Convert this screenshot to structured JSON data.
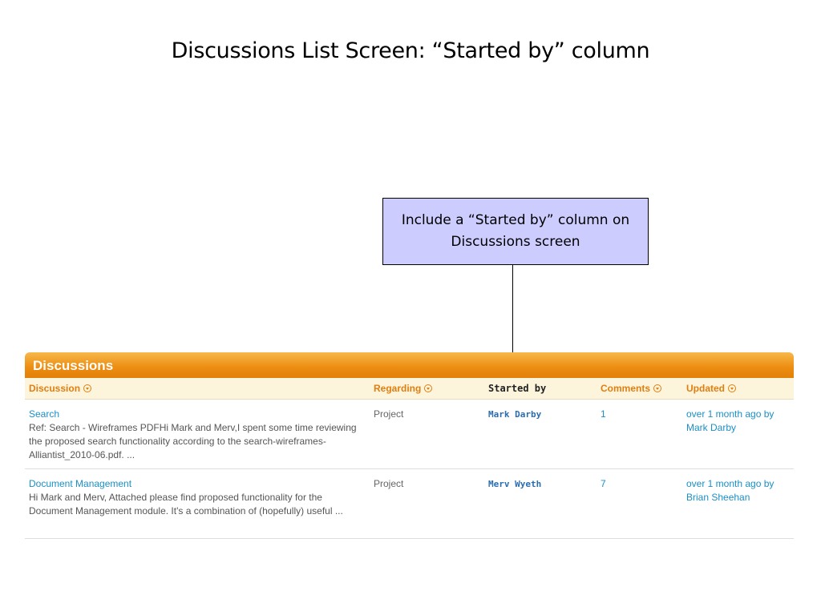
{
  "slide": {
    "title": "Discussions List Screen: “Started by” column",
    "callout": "Include a “Started by” column on Discussions screen"
  },
  "panel": {
    "title": "Discussions",
    "columns": {
      "discussion": "Discussion",
      "regarding": "Regarding",
      "started_by": "Started by",
      "comments": "Comments",
      "updated": "Updated"
    },
    "rows": [
      {
        "title": "Search",
        "excerpt": "Ref: Search - Wireframes PDFHi Mark and Merv,I spent some time reviewing the proposed search functionality according to the search-wireframes-Alliantist_2010-06.pdf. ...",
        "regarding": "Project",
        "started_by": "Mark Darby",
        "comments": "1",
        "updated": "over 1 month ago by",
        "updated_by": "Mark Darby"
      },
      {
        "title": "Document Management",
        "excerpt": "Hi Mark and Merv, Attached please find proposed functionality for the Document Management module. It's a combination of (hopefully) useful ...",
        "regarding": "Project",
        "started_by": "Merv Wyeth",
        "comments": "7",
        "updated": "over 1 month ago by",
        "updated_by": "Brian Sheehan"
      }
    ]
  }
}
